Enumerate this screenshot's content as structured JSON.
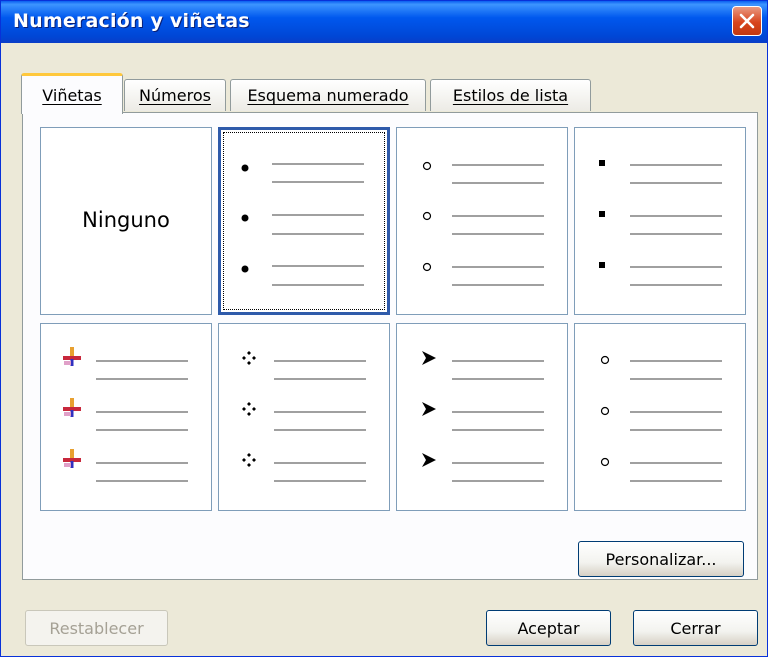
{
  "window": {
    "title": "Numeración y viñetas"
  },
  "tabs": [
    {
      "label": "Viñetas",
      "active": true
    },
    {
      "label": "Números",
      "active": false
    },
    {
      "label": "Esquema numerado",
      "active": false
    },
    {
      "label": "Estilos de lista",
      "active": false
    }
  ],
  "gallery": {
    "none_label": "Ninguno",
    "selected_index": 1,
    "styles": [
      "none",
      "filled-circle-bullet",
      "hollow-circle-bullet",
      "square-bullet",
      "picture-bullet",
      "four-diamond-bullet",
      "arrowhead-bullet",
      "hollow-circle-bullet"
    ]
  },
  "buttons": {
    "customize": "Personalizar...",
    "reset": "Restablecer",
    "ok": "Aceptar",
    "close": "Cerrar"
  },
  "colors": {
    "title_bar": "#0058EE",
    "selection": "#2E5AAA",
    "tab_highlight": "#FFC83C"
  }
}
